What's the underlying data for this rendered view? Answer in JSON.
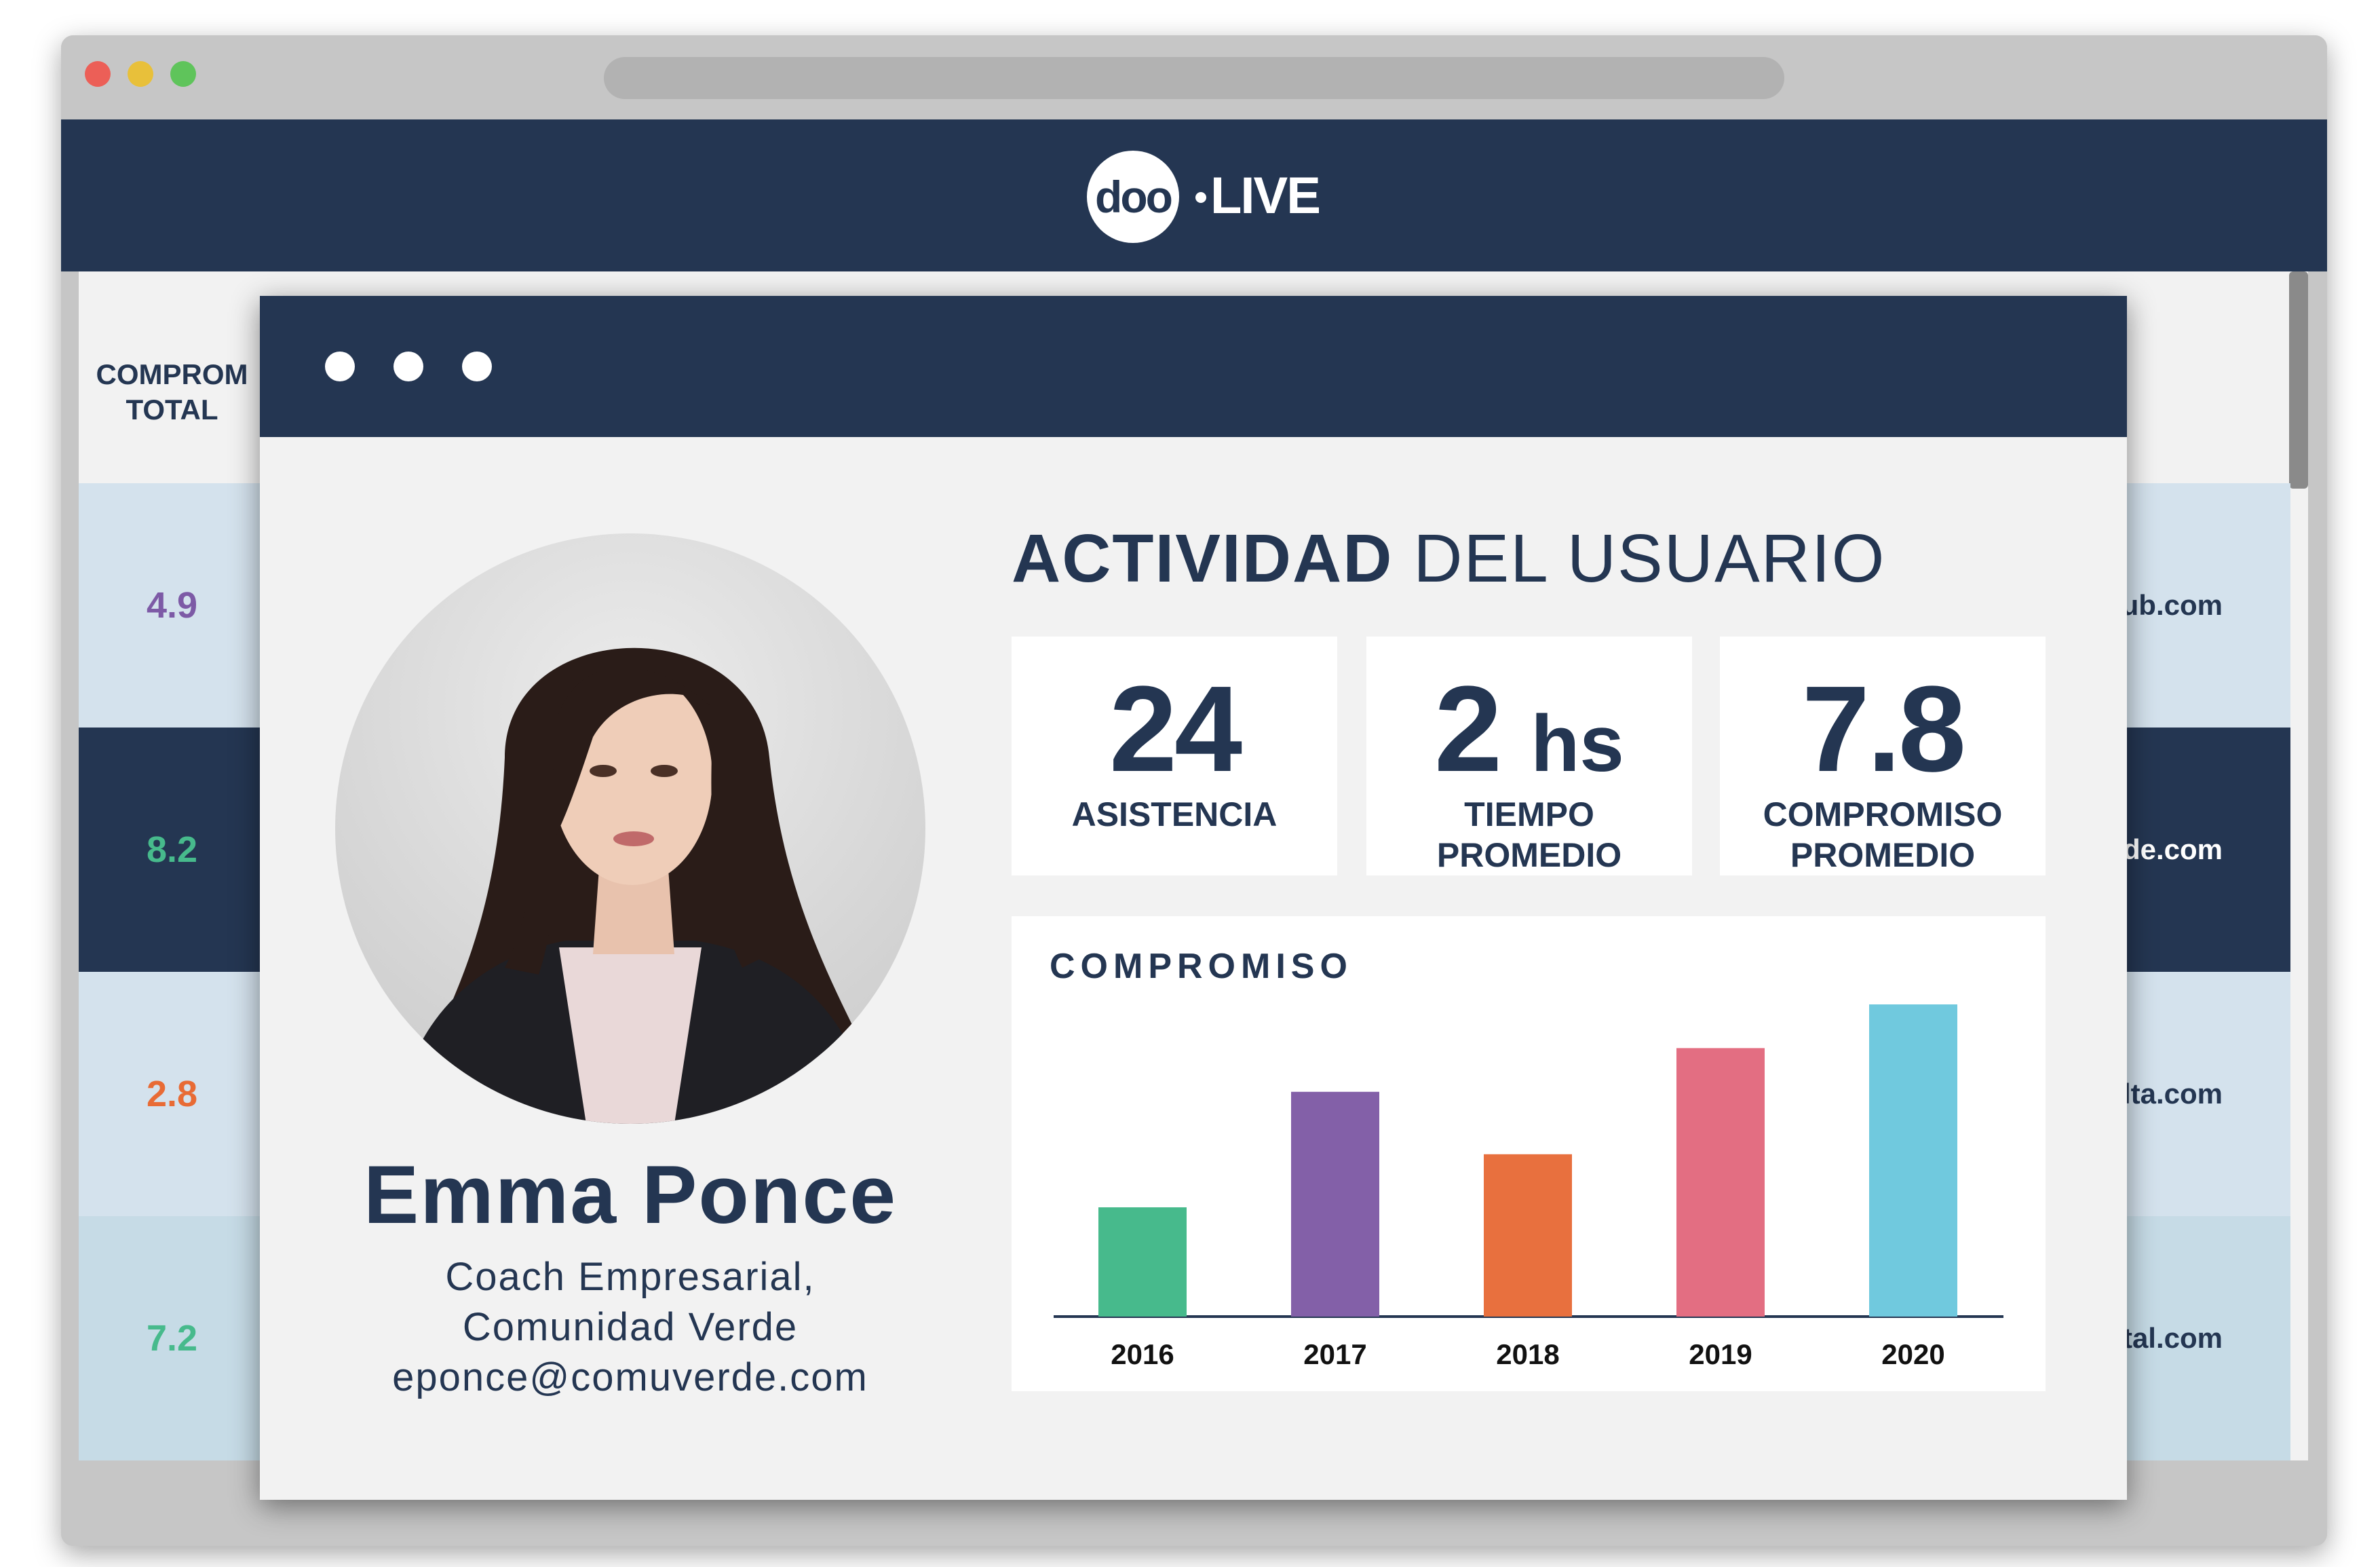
{
  "app": {
    "logo_left": "doo",
    "logo_right": "LIVE"
  },
  "table": {
    "column_header_line1": "COMPROM",
    "column_header_line2": "TOTAL",
    "rows": [
      {
        "value": "4.9",
        "email": "lub.com",
        "bg": "#d4e2ed",
        "value_color": "#7d5aa6",
        "email_color": "#243652"
      },
      {
        "value": "8.2",
        "email": "de.com",
        "bg": "#243652",
        "value_color": "#47ba8c",
        "email_color": "#ffffff"
      },
      {
        "value": "2.8",
        "email": "lta.com",
        "bg": "#d4e2ed",
        "value_color": "#e86b35",
        "email_color": "#243652"
      },
      {
        "value": "7.2",
        "email": "ntal.com",
        "bg": "#c6dbe6",
        "value_color": "#47ba8c",
        "email_color": "#243652"
      }
    ]
  },
  "user": {
    "name": "Emma Ponce",
    "role": "Coach Empresarial,",
    "organization": "Comunidad Verde",
    "email": "eponce@comuverde.com",
    "avatar_icon": "user-photo"
  },
  "activity": {
    "title_bold": "ACTIVIDAD",
    "title_rest": "DEL USUARIO",
    "stats": [
      {
        "value": "24",
        "unit": "",
        "label_line1": "ASISTENCIA",
        "label_line2": ""
      },
      {
        "value": "2",
        "unit": "hs",
        "label_line1": "TIEMPO",
        "label_line2": "PROMEDIO"
      },
      {
        "value": "7.8",
        "unit": "",
        "label_line1": "COMPROMISO",
        "label_line2": "PROMEDIO"
      }
    ]
  },
  "chart_data": {
    "type": "bar",
    "title": "COMPROMISO",
    "categories": [
      "2016",
      "2017",
      "2018",
      "2019",
      "2020"
    ],
    "values": [
      3.5,
      7.2,
      5.2,
      8.6,
      10
    ],
    "colors": [
      "#47ba8c",
      "#8360a8",
      "#e8703e",
      "#e36e82",
      "#70c9de"
    ],
    "ylim": [
      0,
      10
    ],
    "grid": false,
    "xlabel": "",
    "ylabel": ""
  }
}
